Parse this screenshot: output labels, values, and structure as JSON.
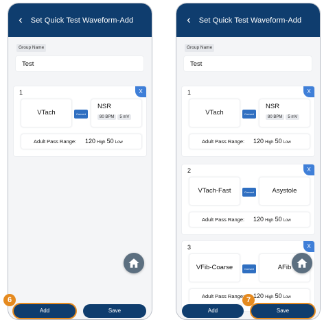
{
  "screens": [
    {
      "title": "Set Quick Test Waveform-Add",
      "group_label": "Group Name",
      "group_value": "Test",
      "cards": [
        {
          "number": "1",
          "delete_label": "X",
          "wave_a": "VTach",
          "wave_b": "NSR",
          "wave_b_bpm": "80 BPM",
          "wave_b_mv": "5 mV",
          "convert_label": "Convert",
          "range_label": "Adult Pass Range:",
          "high_value": "120",
          "high_label": "High",
          "low_value": "50",
          "low_label": "Low"
        }
      ],
      "buttons": {
        "add": "Add",
        "save": "Save"
      },
      "step": "6"
    },
    {
      "title": "Set Quick Test Waveform-Add",
      "group_label": "Group Name",
      "group_value": "Test",
      "cards": [
        {
          "number": "1",
          "delete_label": "X",
          "wave_a": "VTach",
          "wave_b": "NSR",
          "wave_b_bpm": "80 BPM",
          "wave_b_mv": "5 mV",
          "convert_label": "Convert",
          "range_label": "Adult Pass Range:",
          "high_value": "120",
          "high_label": "High",
          "low_value": "50",
          "low_label": "Low"
        },
        {
          "number": "2",
          "delete_label": "X",
          "wave_a": "VTach-Fast",
          "wave_b": "Asystole",
          "convert_label": "Convert",
          "range_label": "Adult Pass Range:",
          "high_value": "120",
          "high_label": "High",
          "low_value": "50",
          "low_label": "Low"
        },
        {
          "number": "3",
          "delete_label": "X",
          "wave_a": "VFib-Coarse",
          "wave_b": "AFib",
          "convert_label": "Convert",
          "range_label": "Adult Pass Range:",
          "high_value": "120",
          "high_label": "High",
          "low_value": "50",
          "low_label": "Low"
        }
      ],
      "buttons": {
        "add": "Add",
        "save": "Save"
      },
      "step": "7"
    }
  ],
  "colors": {
    "header": "#0f3d6e",
    "delete": "#3f7fd8",
    "highlight": "#e58a1f",
    "home_button": "#5c6f80"
  },
  "icons": {
    "back": "chevron-left-icon",
    "home": "home-icon",
    "convert": "convert-icon"
  }
}
